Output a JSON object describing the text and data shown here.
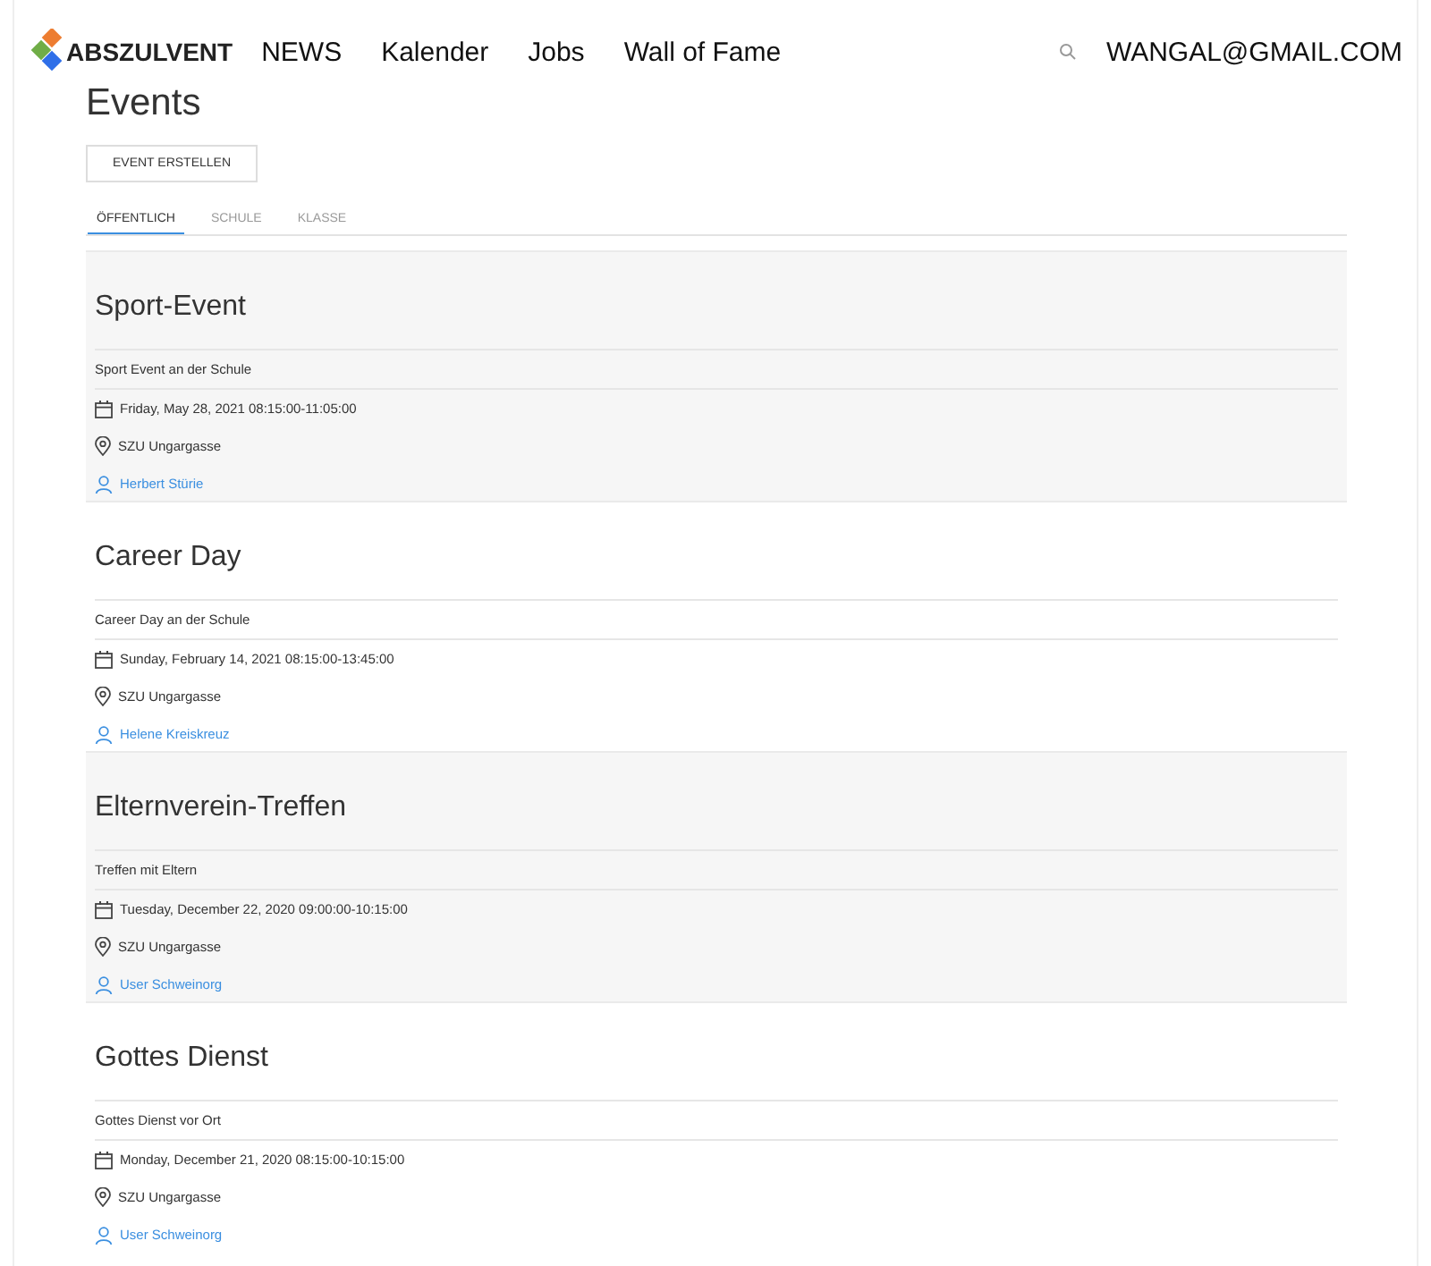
{
  "nav": {
    "logo": "ABSZULVENT",
    "links": [
      "NEWS",
      "Kalender",
      "Jobs",
      "Wall of Fame"
    ],
    "user": "WANGAL@GMAIL.COM"
  },
  "page": {
    "title": "Events",
    "create_button": "EVENT ERSTELLEN"
  },
  "tabs": [
    {
      "label": "ÖFFENTLICH",
      "selected": true
    },
    {
      "label": "SCHULE",
      "selected": false
    },
    {
      "label": "KLASSE",
      "selected": false
    }
  ],
  "events": [
    {
      "title": "Sport-Event",
      "description": "Sport Event an der Schule",
      "date": "Friday, May 28, 2021 08:15:00-11:05:00",
      "location": "SZU Ungargasse",
      "organizer": "Herbert Stürie"
    },
    {
      "title": "Career Day",
      "description": "Career Day an der Schule",
      "date": "Sunday, February 14, 2021 08:15:00-13:45:00",
      "location": "SZU Ungargasse",
      "organizer": "Helene Kreiskreuz"
    },
    {
      "title": "Elternverein-Treffen",
      "description": "Treffen mit Eltern",
      "date": "Tuesday, December 22, 2020 09:00:00-10:15:00",
      "location": "SZU Ungargasse",
      "organizer": "User Schweinorg"
    },
    {
      "title": "Gottes Dienst",
      "description": "Gottes Dienst vor Ort",
      "date": "Monday, December 21, 2020 08:15:00-10:15:00",
      "location": "SZU Ungargasse",
      "organizer": "User Schweinorg"
    }
  ]
}
